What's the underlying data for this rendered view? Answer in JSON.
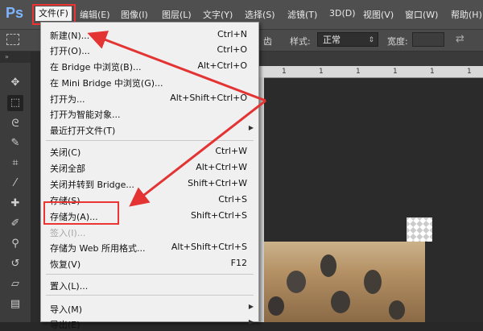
{
  "app": {
    "logo": "Ps",
    "accent_color": "#7fb4ff",
    "highlight_color": "#e33333"
  },
  "menubar": {
    "items": [
      {
        "label": "文件(F)"
      },
      {
        "label": "编辑(E)"
      },
      {
        "label": "图像(I)"
      },
      {
        "label": "图层(L)"
      },
      {
        "label": "文字(Y)"
      },
      {
        "label": "选择(S)"
      },
      {
        "label": "滤镜(T)"
      },
      {
        "label": "3D(D)"
      },
      {
        "label": "视图(V)"
      },
      {
        "label": "窗口(W)"
      },
      {
        "label": "帮助(H)"
      }
    ]
  },
  "options": {
    "partial": "齿",
    "style_label": "样式:",
    "style_value": "正常",
    "width_label": "宽度:"
  },
  "ruler": {
    "ticks": [
      "1",
      "1",
      "1",
      "1",
      "1",
      "1"
    ]
  },
  "file_menu": {
    "items": [
      {
        "label": "新建(N)...",
        "shortcut": "Ctrl+N"
      },
      {
        "label": "打开(O)...",
        "shortcut": "Ctrl+O"
      },
      {
        "label": "在 Bridge 中浏览(B)...",
        "shortcut": "Alt+Ctrl+O"
      },
      {
        "label": "在 Mini Bridge 中浏览(G)...",
        "shortcut": ""
      },
      {
        "label": "打开为...",
        "shortcut": "Alt+Shift+Ctrl+O"
      },
      {
        "label": "打开为智能对象...",
        "shortcut": ""
      },
      {
        "label": "最近打开文件(T)",
        "shortcut": ""
      },
      {
        "label": "关闭(C)",
        "shortcut": "Ctrl+W"
      },
      {
        "label": "关闭全部",
        "shortcut": "Alt+Ctrl+W"
      },
      {
        "label": "关闭并转到 Bridge...",
        "shortcut": "Shift+Ctrl+W"
      },
      {
        "label": "存储(S)",
        "shortcut": "Ctrl+S"
      },
      {
        "label": "存储为(A)...",
        "shortcut": "Shift+Ctrl+S"
      },
      {
        "label": "签入(I)...",
        "shortcut": ""
      },
      {
        "label": "存储为 Web 所用格式...",
        "shortcut": "Alt+Shift+Ctrl+S"
      },
      {
        "label": "恢复(V)",
        "shortcut": "F12"
      },
      {
        "label": "置入(L)...",
        "shortcut": ""
      },
      {
        "label": "导入(M)",
        "shortcut": ""
      },
      {
        "label": "导出(E)",
        "shortcut": ""
      }
    ]
  }
}
